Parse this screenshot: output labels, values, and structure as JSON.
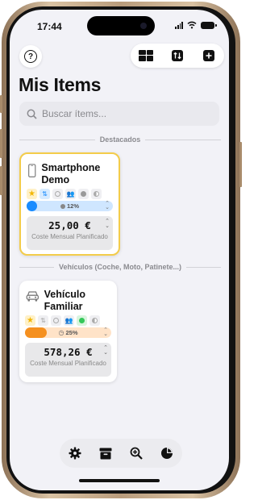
{
  "status": {
    "time": "17:44"
  },
  "header": {
    "title": "Mis Items"
  },
  "search": {
    "placeholder": "Buscar ítems..."
  },
  "sections": {
    "featured": "Destacados",
    "vehicles": "Vehículos (Coche, Moto, Patinete...)"
  },
  "items": [
    {
      "name": "Smartphone Demo",
      "icon": "smartphone-icon",
      "progress_label": "12%",
      "progress": 0.12,
      "cost": "25,00 €",
      "cost_label": "Coste Mensual Planificado",
      "accent": "#f3cc4a",
      "bar_color": "#1a8cff",
      "bar_bg": "#cfe6ff"
    },
    {
      "name": "Vehículo Familiar",
      "icon": "car-icon",
      "progress_label": "25%",
      "progress": 0.25,
      "cost": "578,26 €",
      "cost_label": "Coste Mensual Planificado",
      "bar_color": "#f5901f",
      "bar_bg": "#ffe3c8"
    }
  ],
  "bottom_nav": [
    "gear-icon",
    "archive-icon",
    "zoom-in-icon",
    "pie-chart-icon"
  ]
}
